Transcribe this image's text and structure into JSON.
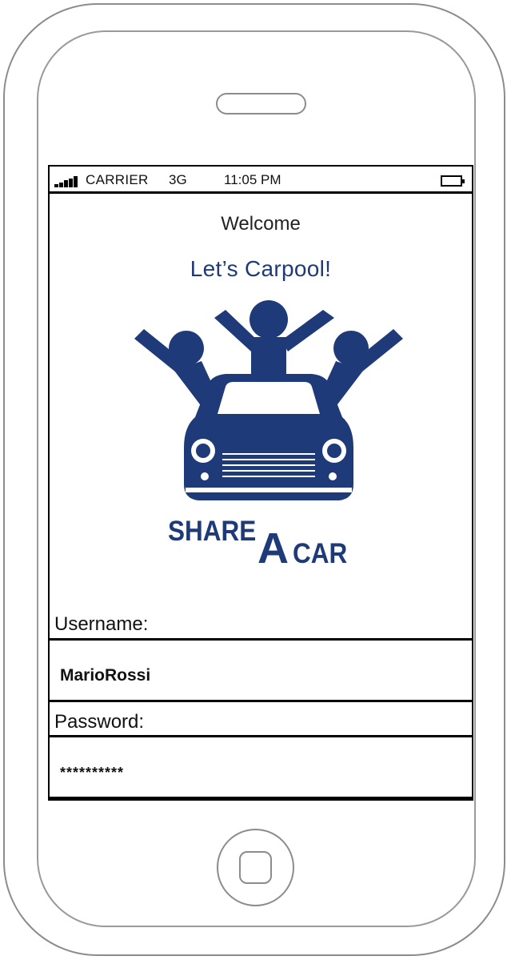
{
  "status_bar": {
    "carrier": "CARRIER",
    "network": "3G",
    "time": "11:05 PM",
    "signal_icon": "signal-bars-icon",
    "battery_icon": "battery-icon"
  },
  "header": {
    "welcome": "Welcome",
    "tagline": "Let’s Carpool!"
  },
  "logo": {
    "text_share": "SHARE",
    "text_a": "A",
    "text_car": "CAR",
    "color": "#1e3a78"
  },
  "login_form": {
    "username_label": "Username:",
    "username_value": "MarioRossi",
    "password_label": "Password:",
    "password_value": "**********"
  }
}
